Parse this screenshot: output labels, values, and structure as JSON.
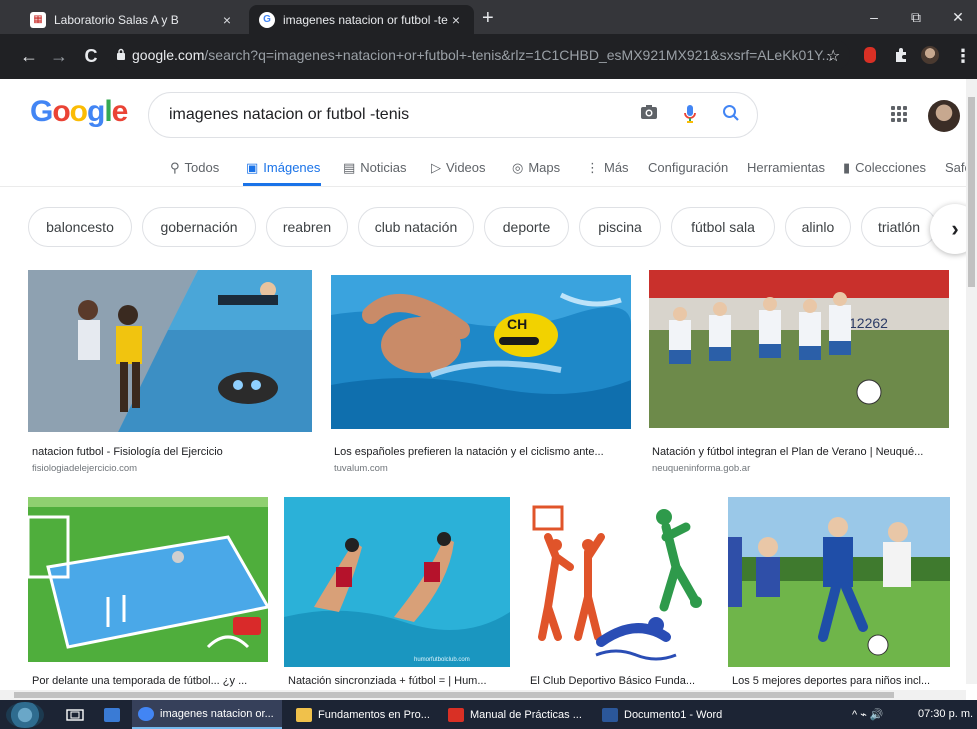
{
  "browser": {
    "tabs": [
      {
        "title": "Laboratorio Salas A y B",
        "icon": "calendar-favicon",
        "active": false
      },
      {
        "title": "imagenes natacion or futbol -teni",
        "icon": "google-favicon",
        "active": true
      }
    ],
    "close_glyph": "×",
    "newtab_glyph": "+",
    "window_controls": {
      "minimize": "–",
      "maximize": "⧉",
      "close": "✕"
    },
    "nav": {
      "back": "←",
      "forward": "→",
      "reload": "C"
    },
    "url_domain": "google.com",
    "url_path": "/search?q=imagenes+natacion+or+futbol+-tenis&rlz=1C1CHBD_esMX921MX921&sxsrf=ALeKk01Y...",
    "lock_glyph": "🔒",
    "star_glyph": "☆"
  },
  "google": {
    "logo_letters": [
      {
        "ch": "G",
        "color": "#4285f4"
      },
      {
        "ch": "o",
        "color": "#ea4335"
      },
      {
        "ch": "o",
        "color": "#fbbc05"
      },
      {
        "ch": "g",
        "color": "#4285f4"
      },
      {
        "ch": "l",
        "color": "#34a853"
      },
      {
        "ch": "e",
        "color": "#ea4335"
      }
    ],
    "query": "imagenes natacion or futbol -tenis",
    "tabs": [
      {
        "label": "Todos",
        "icon": "🔍",
        "active": false
      },
      {
        "label": "Imágenes",
        "icon": "▣",
        "active": true
      },
      {
        "label": "Noticias",
        "icon": "▤",
        "active": false
      },
      {
        "label": "Videos",
        "icon": "▷",
        "active": false
      },
      {
        "label": "Maps",
        "icon": "◎",
        "active": false
      },
      {
        "label": "Más",
        "icon": "⋮",
        "active": false
      }
    ],
    "tools": {
      "settings": "Configuración",
      "tools": "Herramientas",
      "collections": "Colecciones",
      "safesearch": "Safe"
    },
    "chips": [
      "baloncesto",
      "gobernación",
      "reabren",
      "club natación",
      "deporte",
      "piscina",
      "fútbol sala",
      "alinlo",
      "triatlón"
    ],
    "chip_next": "›"
  },
  "results": [
    {
      "caption": "natacion futbol - Fisiología del Ejercicio",
      "source": "fisiologiadelejercicio.com"
    },
    {
      "caption": "Los españoles prefieren la natación y el ciclismo ante...",
      "source": "tuvalum.com"
    },
    {
      "caption": "Natación y fútbol integran el Plan de Verano | Neuqué...",
      "source": "neuqueninforma.gob.ar"
    },
    {
      "caption": "Por delante una temporada de fútbol... ¿y ...",
      "source": ""
    },
    {
      "caption": "Natación sincronziada + fútbol = | Hum...",
      "source": ""
    },
    {
      "caption": "El Club Deportivo Básico Funda...",
      "source": ""
    },
    {
      "caption": "Los 5 mejores deportes para niños incl...",
      "source": ""
    }
  ],
  "image_text": {
    "soccer_sign": "12262",
    "cap_letters": "CH",
    "watermark": "humorfutbolclub.com"
  },
  "taskbar": {
    "items": [
      {
        "label": "imagenes natacion or...",
        "active": true,
        "color": "#4285f4"
      },
      {
        "label": "Fundamentos en Pro...",
        "active": false,
        "color": "#f0c14b"
      },
      {
        "label": "Manual de Prácticas ...",
        "active": false,
        "color": "#d93025"
      },
      {
        "label": "Documento1 - Word",
        "active": false,
        "color": "#2b579a"
      }
    ],
    "tray_icons": "^ ⌁ 🔊",
    "clock": "07:30 p. m."
  },
  "colors": {
    "accent": "#1a73e8",
    "chrome_dark": "#202124",
    "tabstrip": "#35363a"
  }
}
